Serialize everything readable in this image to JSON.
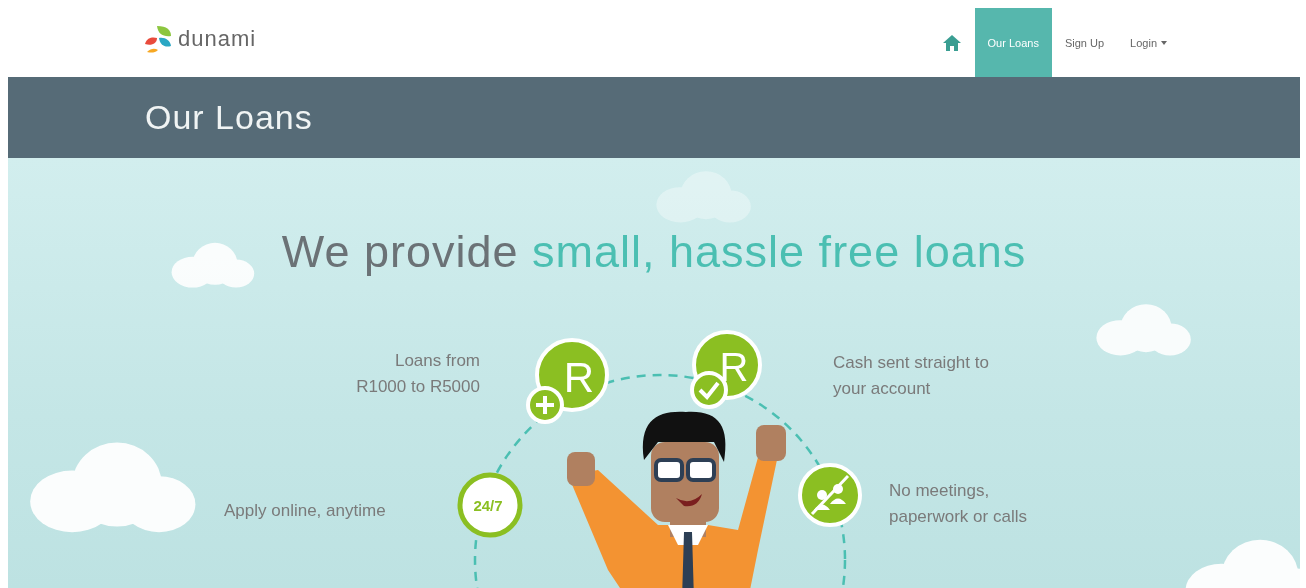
{
  "nav": {
    "logo": "dunami",
    "items": [
      {
        "kind": "home",
        "selected": false
      },
      {
        "kind": "link",
        "label": "Our Loans",
        "selected": true
      },
      {
        "kind": "link",
        "label": "Sign Up",
        "selected": false
      },
      {
        "kind": "dropdown",
        "label": "Login",
        "selected": false
      }
    ]
  },
  "header": {
    "title": "Our Loans"
  },
  "hero": {
    "headline": {
      "lead": "We provide",
      "highlight": "small, hassle free loans"
    },
    "features": [
      {
        "lines": [
          "Loans from",
          "R1000 to R5000"
        ]
      },
      {
        "lines": [
          "Cash sent straight to",
          "your account"
        ]
      },
      {
        "lines": [
          "Apply online, anytime"
        ]
      },
      {
        "lines": [
          "No meetings,",
          "paperwork or calls"
        ]
      }
    ],
    "badges": [
      {
        "kind": "rand-plus",
        "label": "R"
      },
      {
        "kind": "rand-check",
        "label": "R"
      },
      {
        "kind": "clock",
        "label": "24/7"
      },
      {
        "kind": "no-meeting"
      }
    ]
  }
}
